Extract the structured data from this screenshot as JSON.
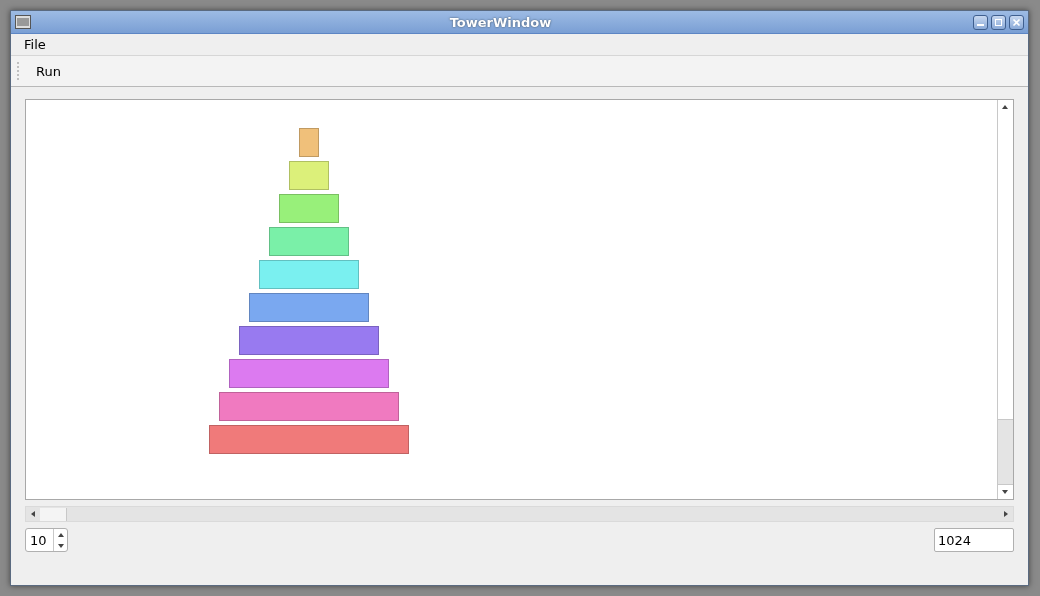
{
  "window": {
    "title": "TowerWindow"
  },
  "menu": [
    "File"
  ],
  "toolbar": {
    "buttons": [
      "Run"
    ]
  },
  "tower": {
    "disks": [
      {
        "color": "#f0c07a"
      },
      {
        "color": "#dcf07a"
      },
      {
        "color": "#98f07a"
      },
      {
        "color": "#7af0a8"
      },
      {
        "color": "#7af0f0"
      },
      {
        "color": "#7aa8f0"
      },
      {
        "color": "#987af0"
      },
      {
        "color": "#dc7af0"
      },
      {
        "color": "#f07ac0"
      },
      {
        "color": "#f07a7a"
      }
    ]
  },
  "disk_count": {
    "value": "10"
  },
  "moves_field": {
    "value": "1024"
  }
}
